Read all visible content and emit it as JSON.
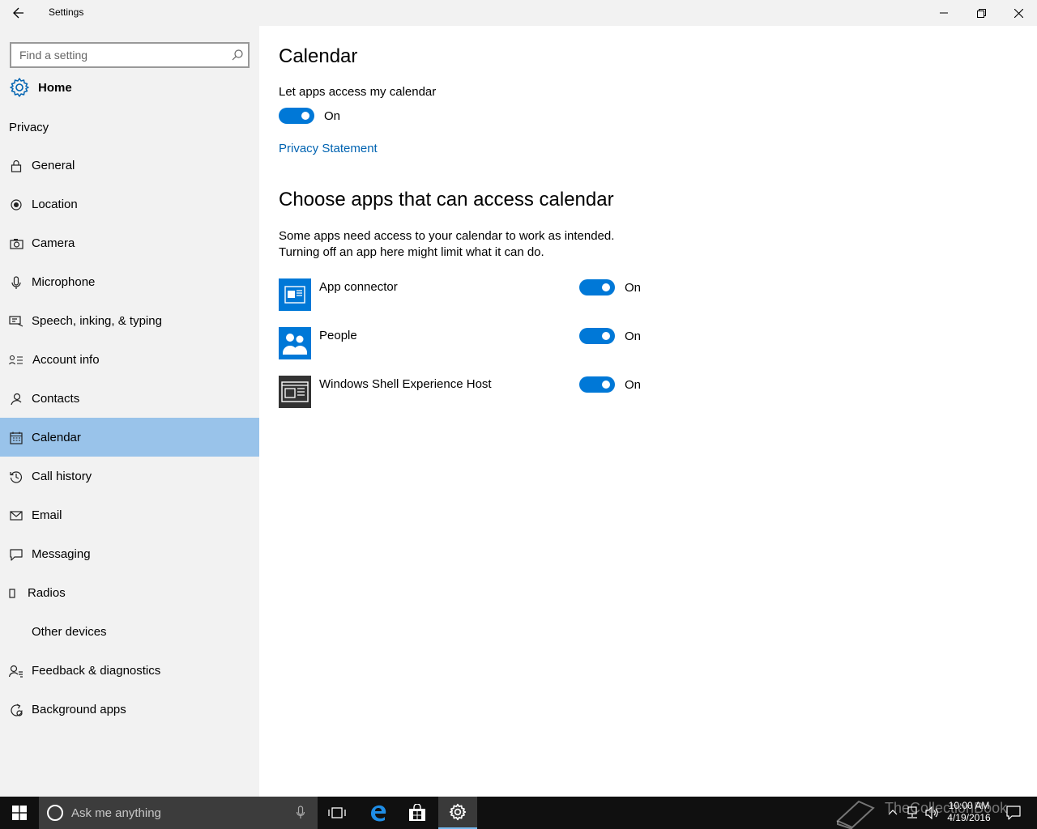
{
  "window": {
    "title": "Settings",
    "back_icon": "back-arrow-icon",
    "controls": [
      "minimize-icon",
      "restore-icon",
      "close-icon"
    ]
  },
  "sidebar": {
    "search_placeholder": "Find a setting",
    "home_label": "Home",
    "group_label": "Privacy",
    "items": [
      {
        "label": "General",
        "icon": "lock-icon"
      },
      {
        "label": "Location",
        "icon": "location-icon"
      },
      {
        "label": "Camera",
        "icon": "camera-icon"
      },
      {
        "label": "Microphone",
        "icon": "microphone-icon"
      },
      {
        "label": "Speech, inking, & typing",
        "icon": "speech-icon"
      },
      {
        "label": "Account info",
        "icon": "account-info-icon"
      },
      {
        "label": "Contacts",
        "icon": "contacts-icon"
      },
      {
        "label": "Calendar",
        "icon": "calendar-icon",
        "selected": true
      },
      {
        "label": "Call history",
        "icon": "history-icon"
      },
      {
        "label": "Email",
        "icon": "email-icon"
      },
      {
        "label": "Messaging",
        "icon": "messaging-icon"
      },
      {
        "label": "Radios",
        "icon": "radios-icon"
      },
      {
        "label": "Other devices",
        "icon": "devices-icon"
      },
      {
        "label": "Feedback & diagnostics",
        "icon": "feedback-icon"
      },
      {
        "label": "Background apps",
        "icon": "background-apps-icon"
      }
    ]
  },
  "main": {
    "title": "Calendar",
    "access_label": "Let apps access my calendar",
    "access_toggle_state": "On",
    "privacy_link": "Privacy Statement",
    "section_title": "Choose apps that can access calendar",
    "description_line1": "Some apps need access to your calendar to work as intended.",
    "description_line2": "Turning off an app here might limit what it can do.",
    "apps": [
      {
        "name": "App connector",
        "state": "On"
      },
      {
        "name": "People",
        "state": "On"
      },
      {
        "name": "Windows Shell Experience Host",
        "state": "On"
      }
    ]
  },
  "taskbar": {
    "search_placeholder": "Ask me anything",
    "time": "10:00 AM",
    "date": "4/19/2016",
    "watermark": "TheCollectionBook"
  },
  "colors": {
    "accent": "#0078d7",
    "selected_nav": "#99c3ea",
    "sidebar_bg": "#f2f2f2",
    "link": "#0063b1",
    "taskbar_bg": "#101010"
  }
}
